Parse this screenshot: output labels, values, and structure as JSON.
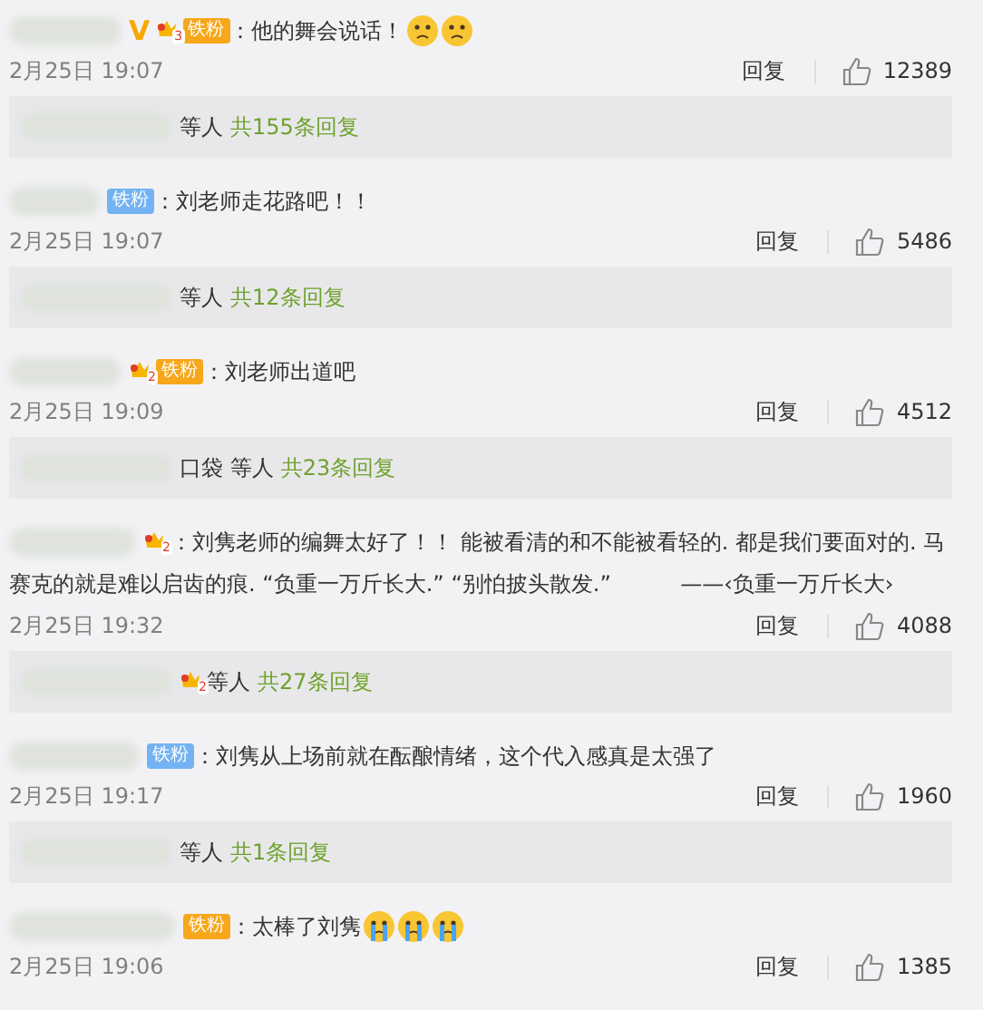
{
  "comments": [
    {
      "badges": [
        {
          "kind": "v",
          "label": "V"
        },
        {
          "kind": "crown",
          "level": "3"
        },
        {
          "kind": "fan-orange",
          "label": "铁粉"
        }
      ],
      "text": "：他的舞会说话！",
      "emojis": [
        {
          "kind": "sad"
        },
        {
          "kind": "sad"
        }
      ],
      "time": "2月25日 19:07",
      "reply": "回复",
      "likes": "12389",
      "summary": {
        "names": "等人",
        "count": "共155条回复"
      }
    },
    {
      "badges": [
        {
          "kind": "fan-blue",
          "label": "铁粉"
        }
      ],
      "text": "：刘老师走花路吧！！",
      "time": "2月25日 19:07",
      "reply": "回复",
      "likes": "5486",
      "summary": {
        "names": "等人",
        "count": "共12条回复"
      }
    },
    {
      "badges": [
        {
          "kind": "crown",
          "level": "2"
        },
        {
          "kind": "fan-orange",
          "label": "铁粉"
        }
      ],
      "text": "：刘老师出道吧",
      "time": "2月25日 19:09",
      "reply": "回复",
      "likes": "4512",
      "summary": {
        "names": "口袋 等人",
        "count": "共23条回复"
      }
    },
    {
      "badges": [
        {
          "kind": "crown",
          "level": "2"
        }
      ],
      "text": "：刘隽老师的编舞太好了！！ 能被看清的和不能被看轻的. 都是我们要面对的. 马",
      "text_wrap": "赛克的就是难以启齿的痕. “负重一万斤长大.” “别怕披头散发.”          ——‹负重一万斤长大›",
      "time": "2月25日 19:32",
      "reply": "回复",
      "likes": "4088",
      "summary": {
        "badge": {
          "kind": "crown",
          "level": "2"
        },
        "names": "等人",
        "count": "共27条回复"
      }
    },
    {
      "badges": [
        {
          "kind": "fan-blue",
          "label": "铁粉"
        }
      ],
      "text": "：刘隽从上场前就在酝酿情绪，这个代入感真是太强了",
      "time": "2月25日 19:17",
      "reply": "回复",
      "likes": "1960",
      "summary": {
        "names": "等人",
        "count": "共1条回复"
      }
    },
    {
      "badges": [
        {
          "kind": "fan-orange",
          "label": "铁粉"
        }
      ],
      "text": "：太棒了刘隽",
      "emojis": [
        {
          "kind": "cry"
        },
        {
          "kind": "cry"
        },
        {
          "kind": "cry"
        }
      ],
      "time": "2月25日 19:06",
      "reply": "回复",
      "likes": "1385"
    }
  ]
}
